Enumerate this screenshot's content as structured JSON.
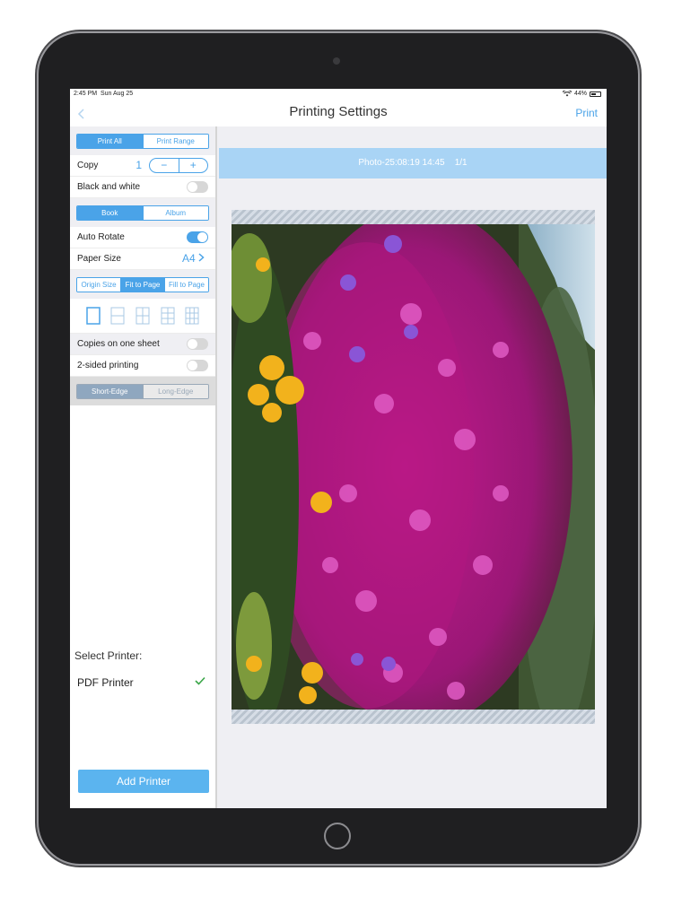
{
  "status_bar": {
    "time": "2:45 PM",
    "date": "Sun Aug 25",
    "battery": "44%",
    "battery_level": 0.44
  },
  "nav": {
    "title": "Printing Settings",
    "print_label": "Print",
    "back_icon": "chevron-left-icon"
  },
  "print_scope": {
    "options": [
      "Print All",
      "Print Range"
    ],
    "selected": "Print All"
  },
  "copy": {
    "label": "Copy",
    "value": "1",
    "minus": "−",
    "plus": "+"
  },
  "black_and_white": {
    "label": "Black and white",
    "on": false
  },
  "mode": {
    "options": [
      "Book",
      "Album"
    ],
    "selected": "Book"
  },
  "auto_rotate": {
    "label": "Auto Rotate",
    "on": true
  },
  "paper_size": {
    "label": "Paper Size",
    "value": "A4"
  },
  "fit": {
    "options": [
      "Origin Size",
      "Fit to Page",
      "Fill to Page"
    ],
    "selected": "Fit to Page"
  },
  "layouts": [
    "layout-1-icon",
    "layout-2-icon",
    "layout-4-icon",
    "layout-6-icon",
    "layout-9-icon"
  ],
  "copies_on_one_sheet": {
    "label": "Copies on one sheet",
    "on": false
  },
  "two_sided": {
    "label": "2-sided printing",
    "on": false
  },
  "edge": {
    "options": [
      "Short-Edge",
      "Long-Edge"
    ],
    "selected": "Short-Edge"
  },
  "printer": {
    "select_label": "Select Printer:",
    "name": "PDF Printer",
    "add_label": "Add Printer"
  },
  "preview": {
    "photo_title": "Photo-25:08:19 14:45",
    "page": "1/1"
  },
  "colors": {
    "accent": "#4aa3e8",
    "photo_bar": "#a9d4f5"
  }
}
